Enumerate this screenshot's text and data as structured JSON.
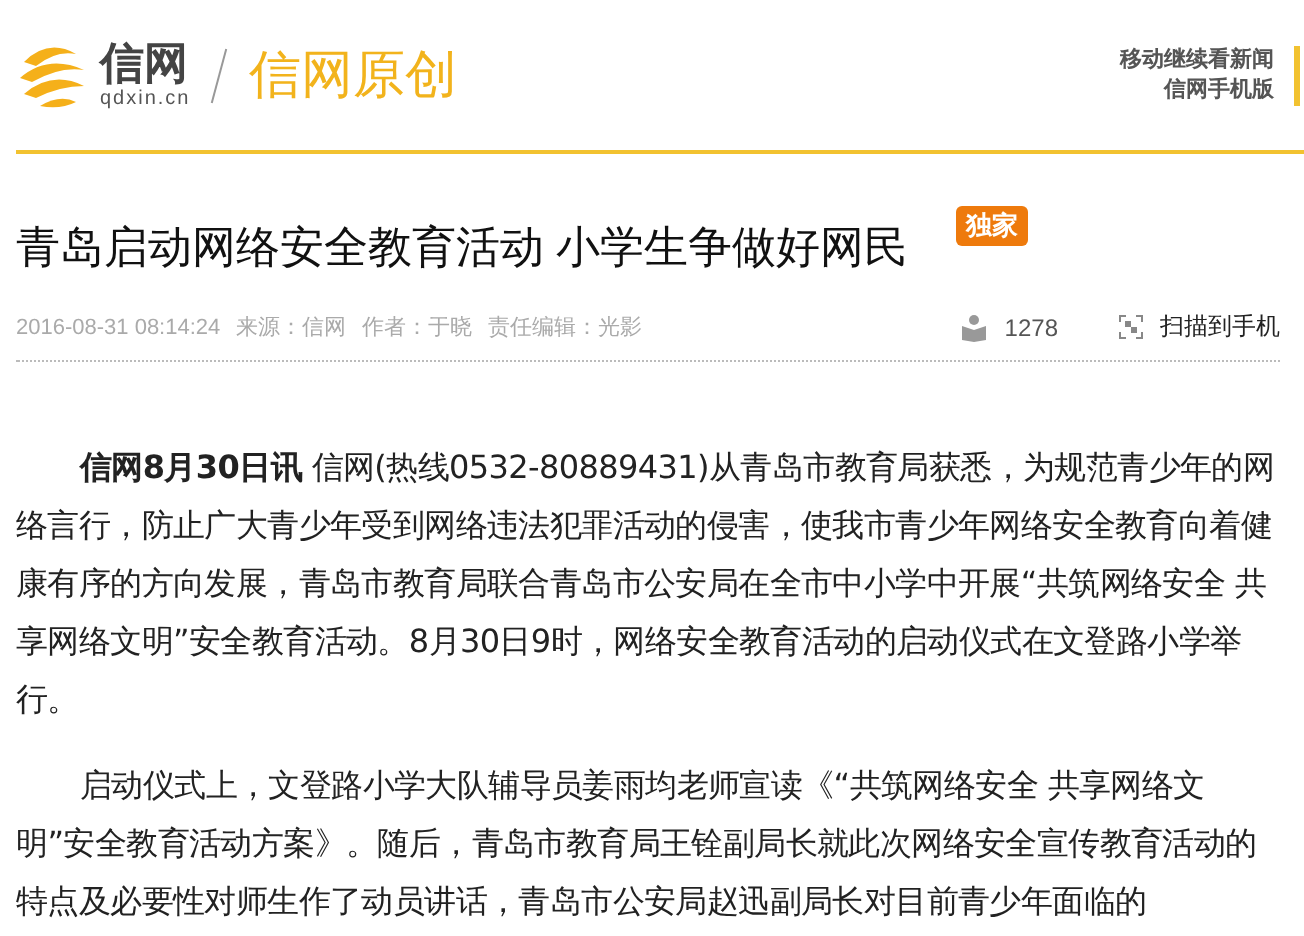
{
  "header": {
    "logo_text": "信网",
    "logo_domain": "qdxin.cn",
    "section": "信网原创",
    "mobile_links": [
      "移动继续看新闻",
      "信网手机版"
    ]
  },
  "article": {
    "title": "青岛启动网络安全教育活动 小学生争做好网民",
    "badge": "独家",
    "meta": {
      "datetime": "2016-08-31 08:14:24",
      "source": "来源：信网",
      "author": "作者：于晓",
      "editor": "责任编辑：光影",
      "views": "1278",
      "scan": "扫描到手机"
    },
    "paragraphs": [
      "**信网8月30日讯** 信网(热线0532-80889431)从青岛市教育局获悉，为规范青少年的网络言行，防止广大青少年受到网络违法犯罪活动的侵害，使我市青少年网络安全教育向着健康有序的方向发展，青岛市教育局联合青岛市公安局在全市中小学中开展“共筑网络安全  共享网络文明”安全教育活动。8月30日9时，网络安全教育活动的启动仪式在文登路小学举行。",
      "启动仪式上，文登路小学大队辅导员姜雨均老师宣读《“共筑网络安全  共享网络文明”安全教育活动方案》。随后，青岛市教育局王铨副局长就此次网络安全宣传教育活动的特点及必要性对师生作了动员讲话，青岛市公安局赵迅副局长对目前青少年面临的"
    ]
  }
}
